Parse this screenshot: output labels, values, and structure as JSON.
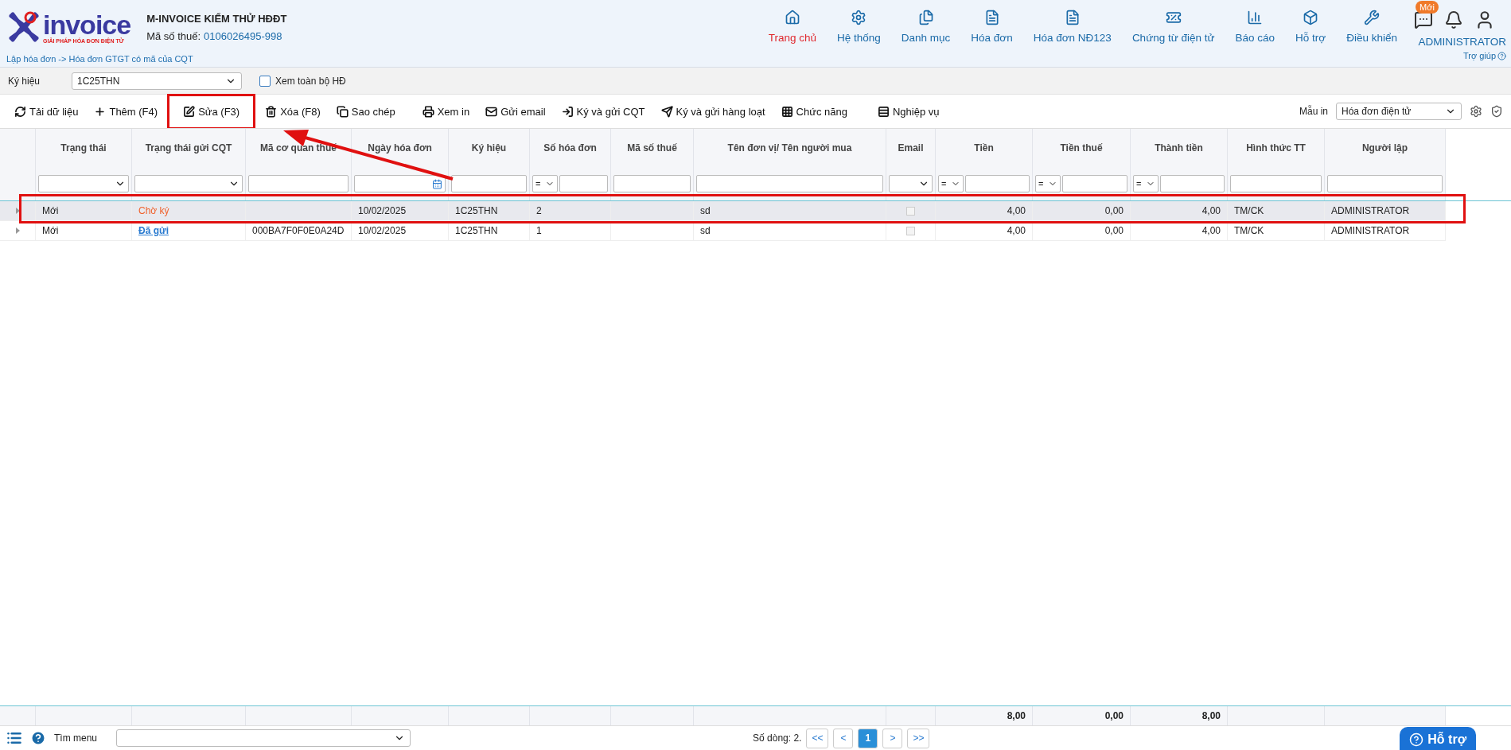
{
  "logo": {
    "word": "invoice",
    "tagline": "GIẢI PHÁP HÓA ĐƠN ĐIỆN TỬ"
  },
  "company": {
    "name": "M-INVOICE KIỂM THỬ HĐĐT",
    "tax_label": "Mã số thuế:",
    "tax_value": "0106026495-998"
  },
  "breadcrumb": "Lập hóa đơn -> Hóa đơn GTGT có mã của CQT",
  "nav": [
    {
      "kind": "home",
      "label": "Trang chủ",
      "selected": true
    },
    {
      "kind": "gear",
      "label": "Hệ thống",
      "selected": false
    },
    {
      "kind": "files",
      "label": "Danh mục",
      "selected": false
    },
    {
      "kind": "doc",
      "label": "Hóa đơn",
      "selected": false
    },
    {
      "kind": "doc",
      "label": "Hóa đơn NĐ123",
      "selected": false
    },
    {
      "kind": "ticket",
      "label": "Chứng từ điện tử",
      "selected": false
    },
    {
      "kind": "chart",
      "label": "Báo cáo",
      "selected": false
    },
    {
      "kind": "box",
      "label": "Hỗ trợ",
      "selected": false
    },
    {
      "kind": "tools",
      "label": "Điều khiển",
      "selected": false
    }
  ],
  "messages_badge": "Mới",
  "user": "ADMINISTRATOR",
  "help_link": "Trợ giúp",
  "filter": {
    "label": "Ký hiệu",
    "value": "1C25THN",
    "show_all": {
      "label": "Xem toàn bộ HĐ",
      "checked": false
    }
  },
  "toolbar": [
    {
      "kind": "refresh",
      "label": "Tải dữ liệu",
      "highlighted": false
    },
    {
      "kind": "plus",
      "label": "Thêm (F4)",
      "highlighted": false
    },
    {
      "kind": "edit",
      "label": "Sửa (F3)",
      "highlighted": true
    },
    {
      "kind": "trash",
      "label": "Xóa (F8)",
      "highlighted": false
    },
    {
      "kind": "copy",
      "label": "Sao chép",
      "highlighted": false
    },
    {
      "kind": "print",
      "label": "Xem in",
      "highlighted": false
    },
    {
      "kind": "mail",
      "label": "Gửi email",
      "highlighted": false
    },
    {
      "kind": "signin",
      "label": "Ký và gửi CQT",
      "highlighted": false
    },
    {
      "kind": "send",
      "label": "Ký và gửi hàng loạt",
      "highlighted": false
    },
    {
      "kind": "grid",
      "label": "Chức năng",
      "highlighted": false
    },
    {
      "kind": "list",
      "label": "Nghiệp vụ",
      "highlighted": false
    }
  ],
  "print_template": {
    "label": "Mẫu in",
    "value": "Hóa đơn điện tử"
  },
  "arrow_annotation": true,
  "table": {
    "columns": [
      {
        "label": "Trạng thái",
        "kind": "text",
        "filter": {
          "kind": "select"
        }
      },
      {
        "label": "Trạng thái gửi CQT",
        "kind": "status",
        "filter": {
          "kind": "select"
        }
      },
      {
        "label": "Mã cơ quan thuế",
        "kind": "text",
        "filter": {
          "kind": "text"
        }
      },
      {
        "label": "Ngày hóa đơn",
        "kind": "text",
        "filter": {
          "kind": "date"
        }
      },
      {
        "label": "Ký hiệu",
        "kind": "text",
        "filter": {
          "kind": "text"
        }
      },
      {
        "label": "Số hóa đơn",
        "kind": "text",
        "filter": {
          "kind": "op",
          "op": "="
        }
      },
      {
        "label": "Mã số thuế",
        "kind": "text",
        "filter": {
          "kind": "text"
        }
      },
      {
        "label": "Tên đơn vị/ Tên người mua",
        "kind": "text",
        "filter": {
          "kind": "text"
        }
      },
      {
        "label": "Email",
        "kind": "check",
        "filter": {
          "kind": "select"
        }
      },
      {
        "label": "Tiền",
        "kind": "money",
        "filter": {
          "kind": "op",
          "op": "="
        }
      },
      {
        "label": "Tiền thuế",
        "kind": "money",
        "filter": {
          "kind": "op",
          "op": "="
        }
      },
      {
        "label": "Thành tiền",
        "kind": "money",
        "filter": {
          "kind": "op",
          "op": "="
        }
      },
      {
        "label": "Hình thức TT",
        "kind": "text",
        "filter": {
          "kind": "text"
        }
      },
      {
        "label": "Người lập",
        "kind": "text",
        "filter": {
          "kind": "text"
        }
      }
    ],
    "rows": [
      {
        "selected": true,
        "highlighted": true,
        "status": "Mới",
        "cqt_status": {
          "text": "Chờ ký",
          "kind": "pending"
        },
        "date": "10/02/2025",
        "symbol": "1C25THN",
        "number": "2",
        "buyer": "sd",
        "email_checked": false,
        "amount": "4,00",
        "tax": "0,00",
        "total": "4,00",
        "payment": "TM/CK",
        "creator": "ADMINISTRATOR"
      },
      {
        "selected": false,
        "highlighted": false,
        "status": "Mới",
        "cqt_status": {
          "text": "Đã gửi",
          "kind": "sent"
        },
        "authority_code": "000BA7F0F0E0A24D",
        "date": "10/02/2025",
        "symbol": "1C25THN",
        "number": "1",
        "buyer": "sd",
        "email_checked": false,
        "amount": "4,00",
        "tax": "0,00",
        "total": "4,00",
        "payment": "TM/CK",
        "creator": "ADMINISTRATOR"
      }
    ],
    "totals": {
      "amount": "8,00",
      "tax": "0,00",
      "total": "8,00"
    }
  },
  "footer": {
    "menu_search_label": "Tìm menu",
    "row_count": "Số dòng: 2.",
    "pages": [
      {
        "label": "<<",
        "selected": false
      },
      {
        "label": "<",
        "selected": false
      },
      {
        "label": "1",
        "selected": true
      },
      {
        "label": ">",
        "selected": false
      },
      {
        "label": ">>",
        "selected": false
      }
    ],
    "support_button": "Hỗ trợ"
  }
}
